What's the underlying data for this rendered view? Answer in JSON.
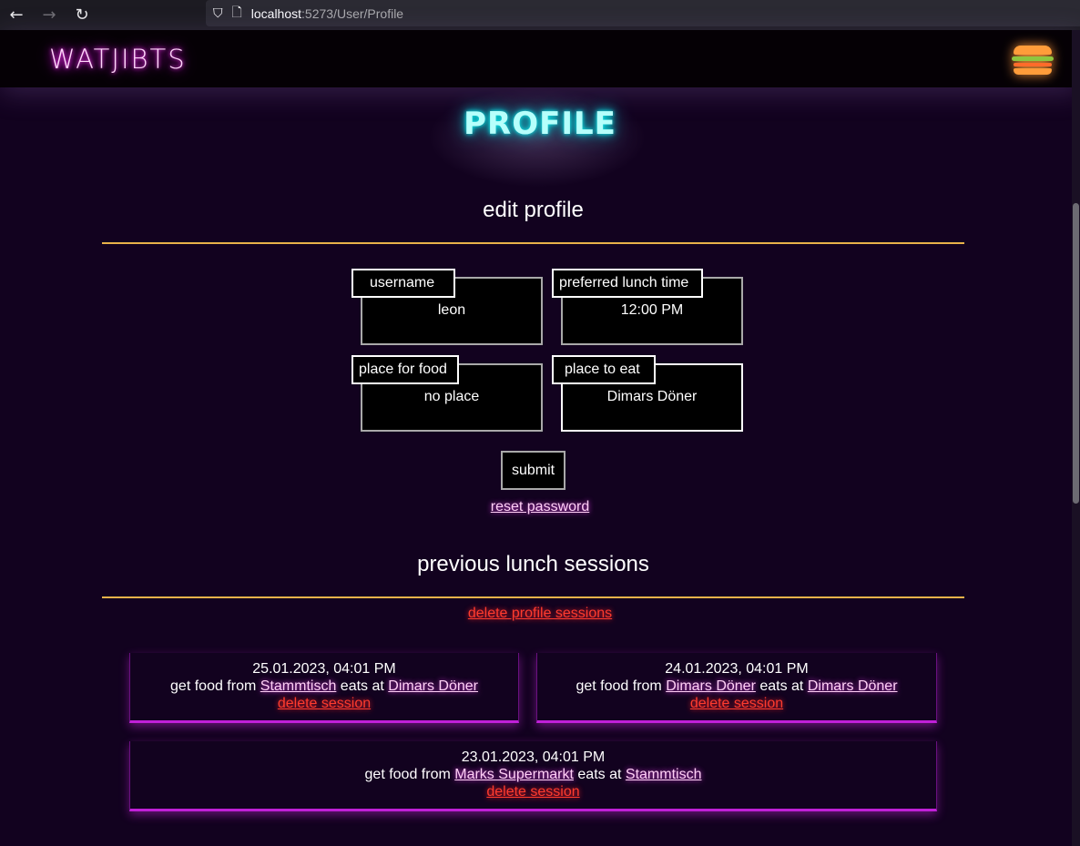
{
  "browser": {
    "back": "←",
    "forward": "→",
    "reload": "↻",
    "url_host": "localhost",
    "url_path": ":5273/User/Profile"
  },
  "app": {
    "brand": "WATJIBTS",
    "menu_icon": "burger-menu-icon"
  },
  "page": {
    "title": "PROFILE"
  },
  "edit_profile": {
    "heading": "edit profile",
    "fields": [
      {
        "label": "username",
        "value": "leon"
      },
      {
        "label": "preferred lunch time",
        "value": "12:00 PM"
      },
      {
        "label": "place for food",
        "value": "no place"
      },
      {
        "label": "place to eat",
        "value": "Dimars Döner"
      }
    ],
    "submit": "submit",
    "reset_password": "reset password"
  },
  "sessions": {
    "heading": "previous lunch sessions",
    "delete_all": "delete profile sessions",
    "prefix_food": "get food from",
    "prefix_eat": "eats at",
    "delete_label": "delete session",
    "items": [
      {
        "date": "25.01.2023, 04:01 PM",
        "food_place": "Stammtisch",
        "eat_place": "Dimars Döner"
      },
      {
        "date": "24.01.2023, 04:01 PM",
        "food_place": "Dimars Döner",
        "eat_place": "Dimars Döner"
      },
      {
        "date": "23.01.2023, 04:01 PM",
        "food_place": "Marks Supermarkt",
        "eat_place": "Stammtisch"
      }
    ]
  },
  "colors": {
    "background": "#12021f",
    "accent_line": "#e8b24a",
    "brand_glow": "#e300e8",
    "title_glow": "#00d0d8",
    "danger": "#ff3b2e"
  }
}
